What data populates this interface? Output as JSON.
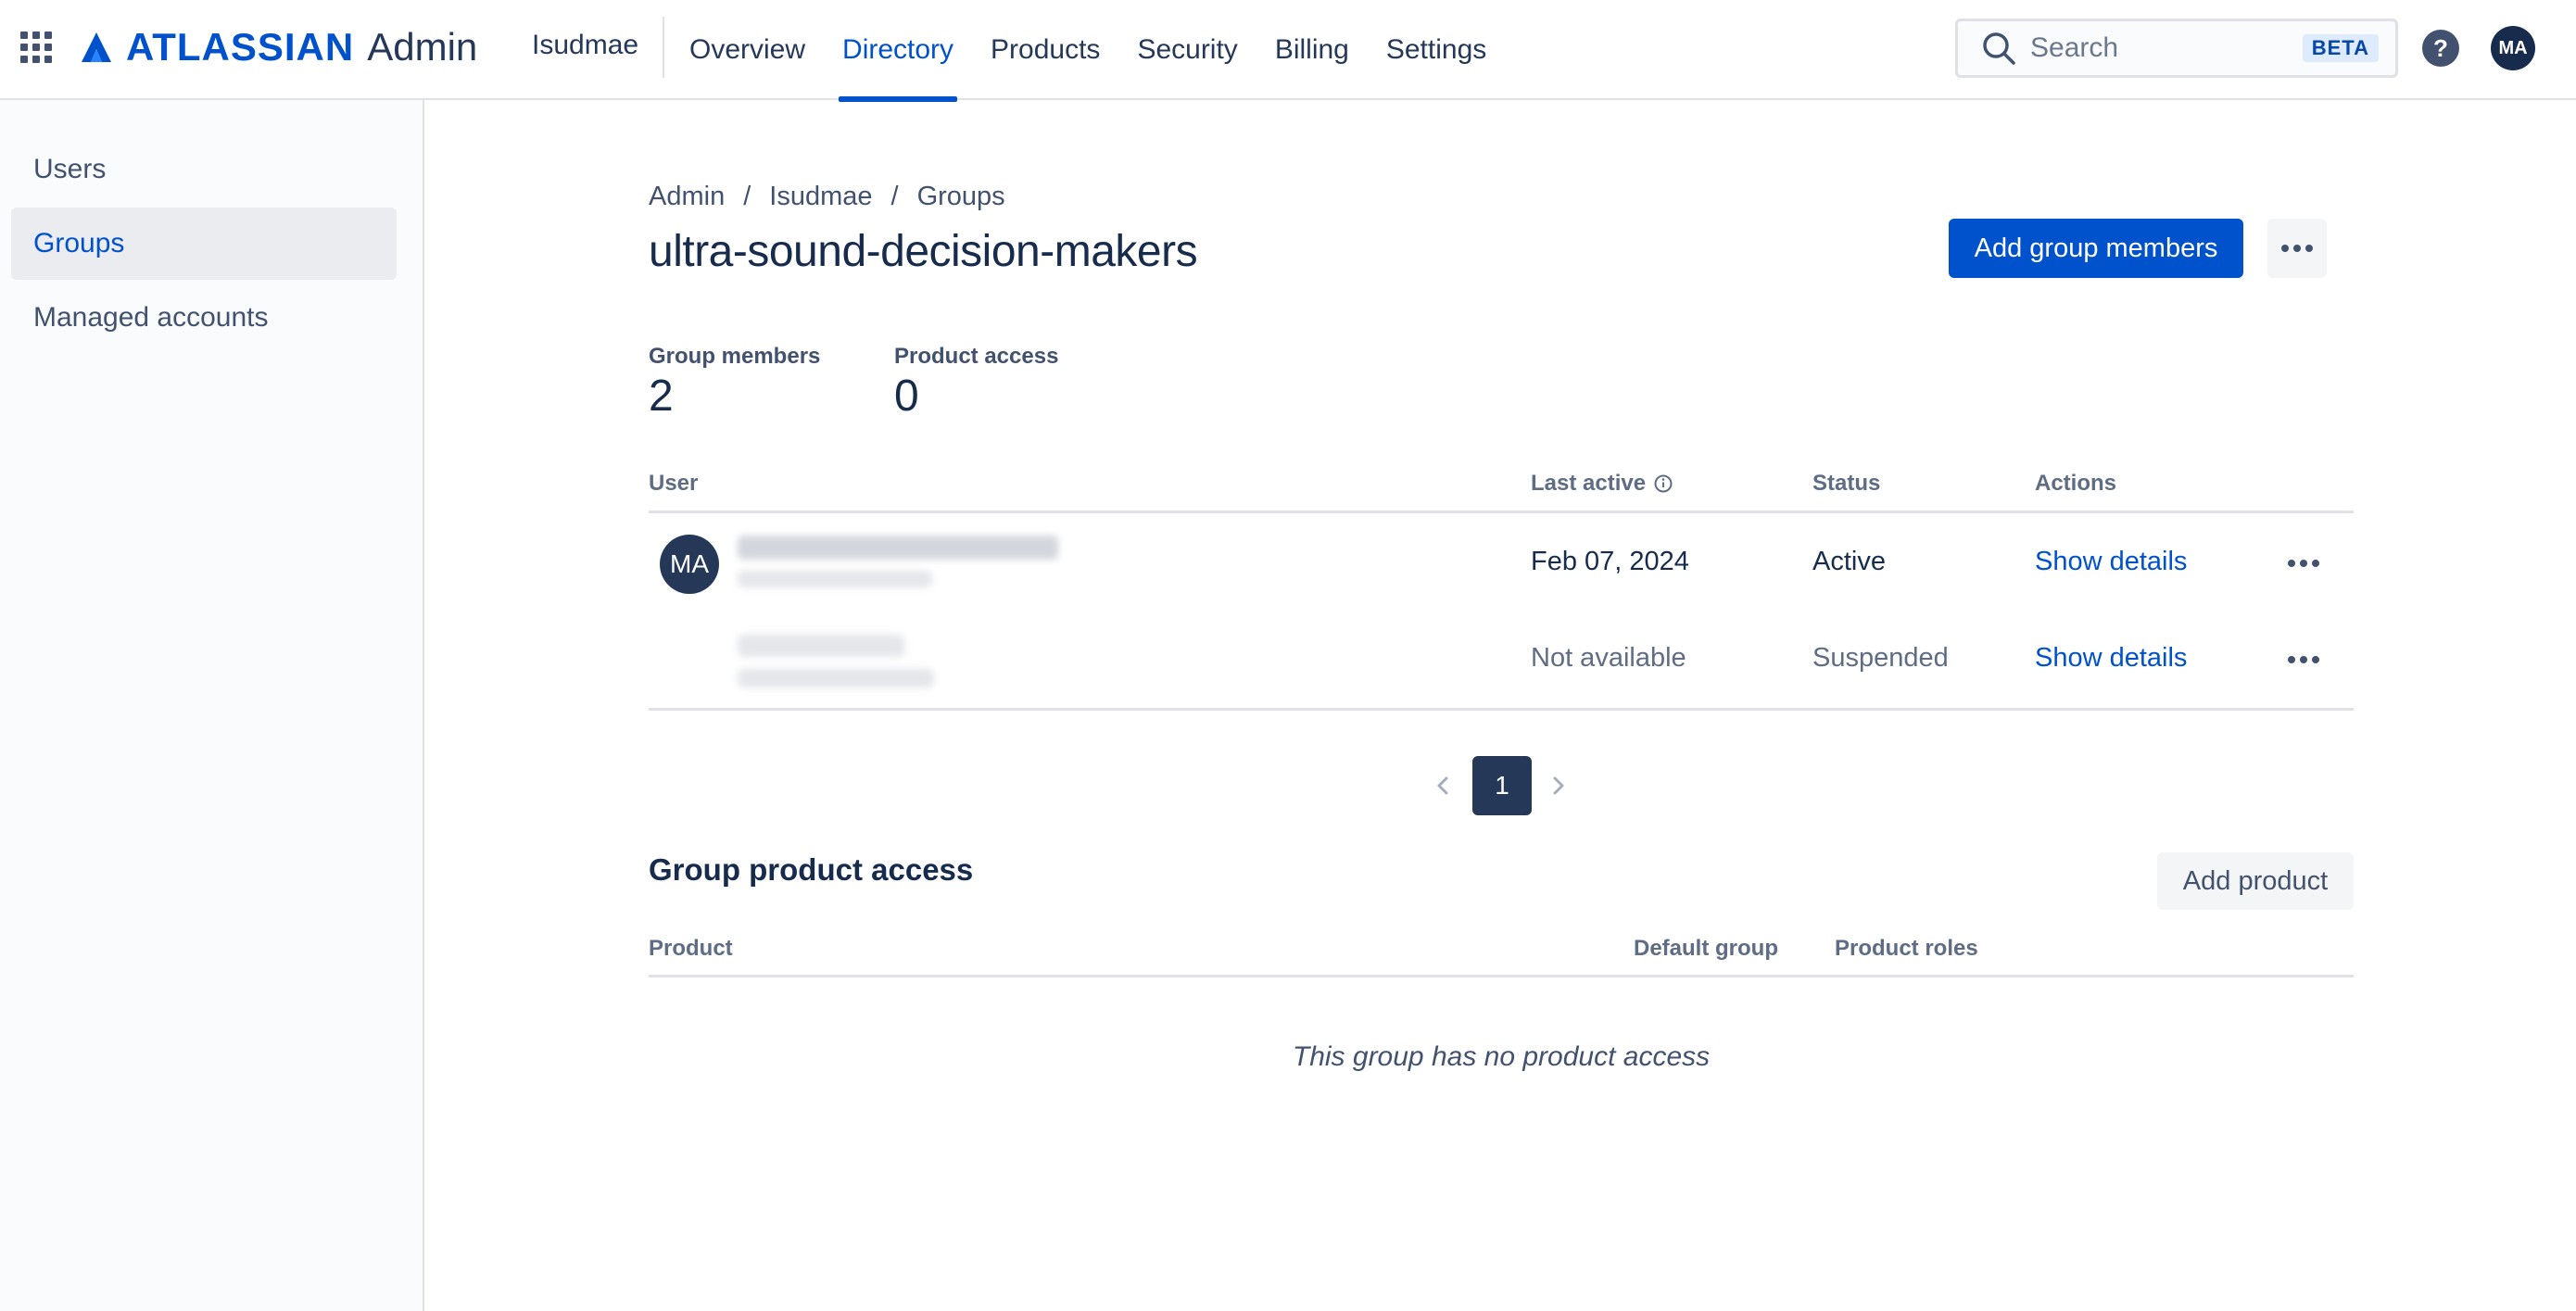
{
  "topbar": {
    "brand": "ATLASSIAN",
    "product": "Admin",
    "org": "Isudmae",
    "nav": [
      "Overview",
      "Directory",
      "Products",
      "Security",
      "Billing",
      "Settings"
    ],
    "active_nav": "Directory",
    "search_placeholder": "Search",
    "search_badge": "BETA",
    "avatar_initials": "MA"
  },
  "sidebar": {
    "items": [
      {
        "label": "Users",
        "active": false
      },
      {
        "label": "Groups",
        "active": true
      },
      {
        "label": "Managed accounts",
        "active": false
      }
    ]
  },
  "main": {
    "breadcrumb": [
      "Admin",
      "Isudmae",
      "Groups"
    ],
    "breadcrumb_separator": "/",
    "title": "ultra-sound-decision-makers",
    "add_members_label": "Add group members",
    "stats": [
      {
        "label": "Group members",
        "value": "2"
      },
      {
        "label": "Product access",
        "value": "0"
      }
    ],
    "members_table": {
      "columns": [
        "User",
        "Last active",
        "Status",
        "Actions"
      ],
      "rows": [
        {
          "avatar": "MA",
          "last_active": "Feb 07, 2024",
          "status": "Active",
          "action": "Show details"
        },
        {
          "avatar": "",
          "last_active": "Not available",
          "status": "Suspended",
          "action": "Show details"
        }
      ]
    },
    "pagination": {
      "current": "1"
    },
    "product_access": {
      "title": "Group product access",
      "add_label": "Add product",
      "columns": [
        "Product",
        "Default group",
        "Product roles"
      ],
      "empty_message": "This group has no product access"
    }
  },
  "colors": {
    "brand_blue": "#0052cc",
    "text_dark": "#172b4d",
    "muted": "#5e6c84",
    "avatar_bg": "#253858"
  }
}
